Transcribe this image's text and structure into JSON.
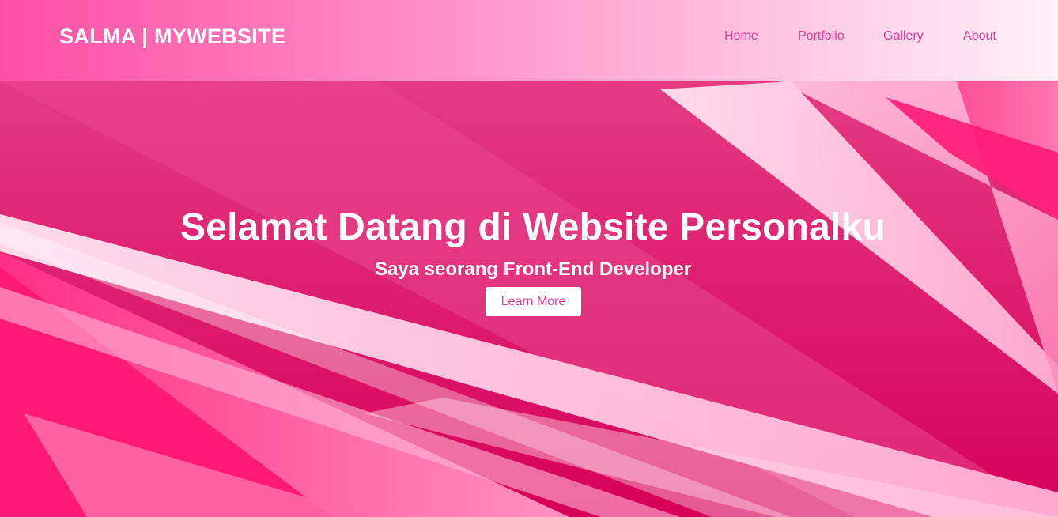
{
  "header": {
    "logo": "SALMA | MYWEBSITE",
    "nav": [
      {
        "label": "Home"
      },
      {
        "label": "Portfolio"
      },
      {
        "label": "Gallery"
      },
      {
        "label": "About"
      }
    ]
  },
  "hero": {
    "title": "Selamat Datang di Website Personalku",
    "subtitle": "Saya seorang Front-End Developer",
    "button_label": "Learn More"
  },
  "colors": {
    "header_gradient_start": "#ff4fa3",
    "header_gradient_end": "#fff2f8",
    "hero_base": "#d60059",
    "accent_text": "#e0409a",
    "white": "#ffffff"
  }
}
